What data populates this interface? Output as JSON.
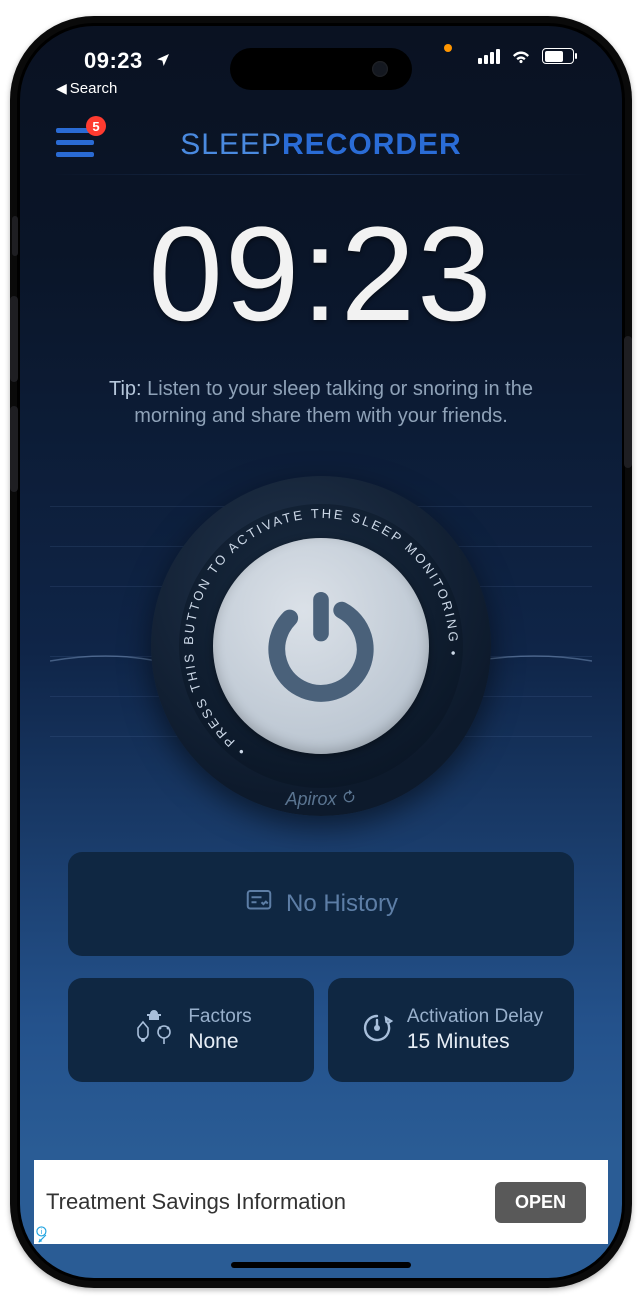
{
  "status": {
    "time": "09:23",
    "back_label": "Search"
  },
  "header": {
    "menu_badge": "5",
    "title_part1": "SLEEP",
    "title_part2": "RECORDER"
  },
  "clock": "09:23",
  "tip": {
    "prefix": "Tip:",
    "text": " Listen to your sleep talking or snoring in the morning and share them with your friends."
  },
  "power": {
    "arc_text": "• PRESS THIS BUTTON TO ACTIVATE THE SLEEP MONITORING •",
    "brand": "Apirox"
  },
  "history": {
    "label": "No History"
  },
  "factors": {
    "label": "Factors",
    "value": "None"
  },
  "activation": {
    "label": "Activation Delay",
    "value": "15 Minutes"
  },
  "ad": {
    "text": "Treatment Savings Information",
    "button": "OPEN"
  }
}
